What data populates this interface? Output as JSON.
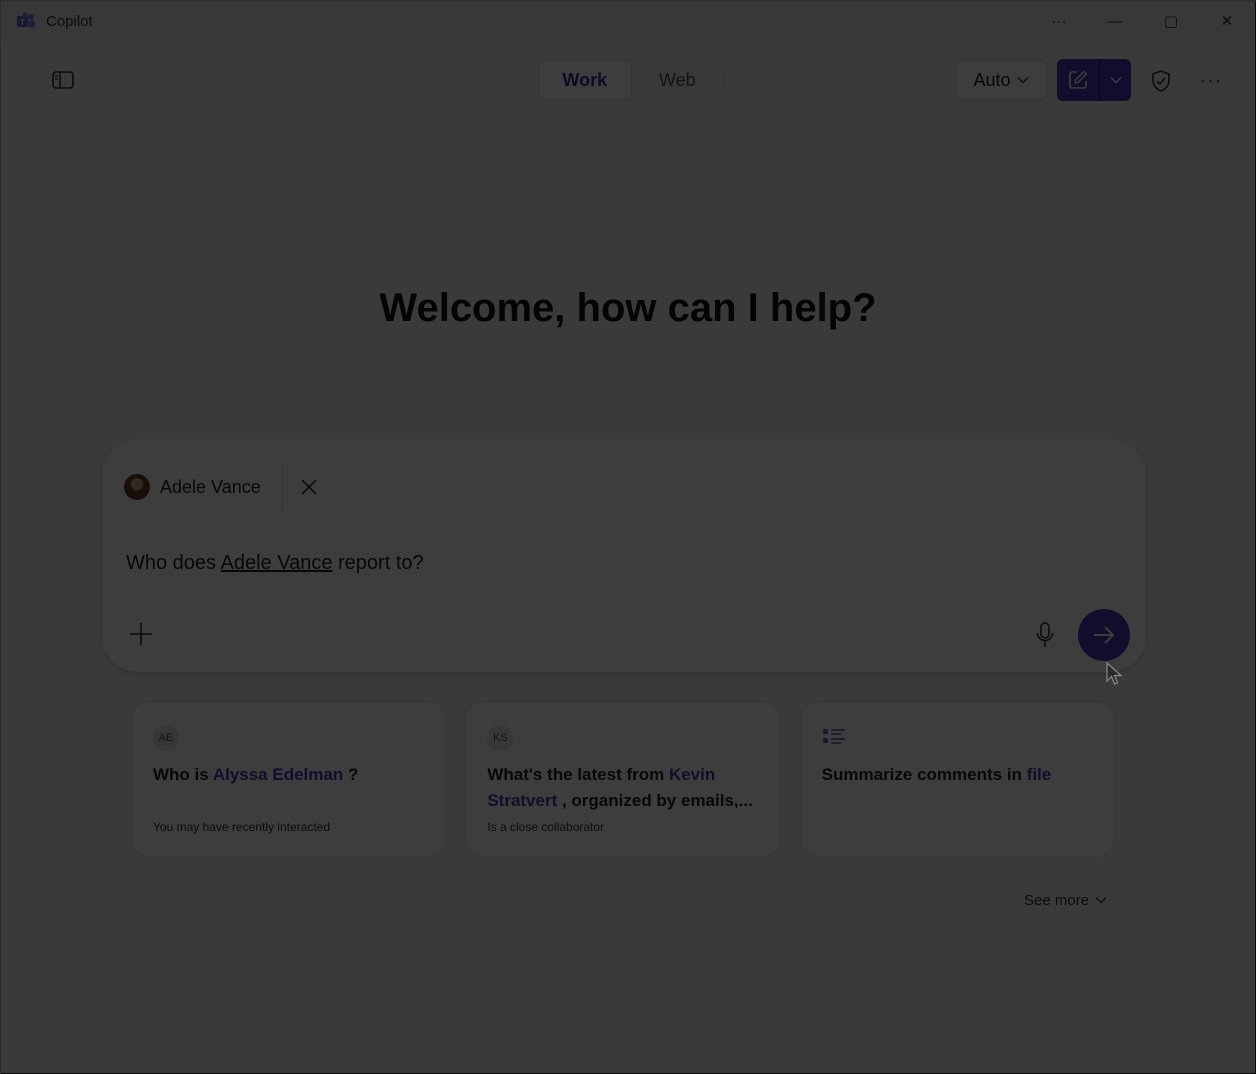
{
  "titlebar": {
    "app_name": "Copilot",
    "more_label": "···",
    "minimize_label": "—",
    "maximize_label": "▢",
    "close_label": "✕"
  },
  "toolbar": {
    "modes": [
      {
        "label": "Work",
        "active": true
      },
      {
        "label": "Web",
        "active": false
      }
    ],
    "model_select": "Auto",
    "more_label": "···"
  },
  "welcome": "Welcome, how can I help?",
  "composer": {
    "mention_name": "Adele Vance",
    "prompt_prefix": "Who does ",
    "prompt_mention": "Adele Vance",
    "prompt_suffix": " report to?"
  },
  "suggestions": [
    {
      "badge": "AE",
      "pre": "Who is ",
      "link": "Alyssa Edelman",
      "post": " ?",
      "hint": "You may have recently interacted"
    },
    {
      "badge": "KS",
      "pre": "What's the latest from ",
      "link": "Kevin Stratvert",
      "post": " , organized by emails,...",
      "hint": "Is a close collaborator"
    },
    {
      "badge": "",
      "pre": "Summarize comments in ",
      "link": "file",
      "post": "",
      "hint": ""
    }
  ],
  "see_more": "See more",
  "colors": {
    "accent": "#4a37b8",
    "overlay": "rgba(0,0,0,0.76)"
  }
}
